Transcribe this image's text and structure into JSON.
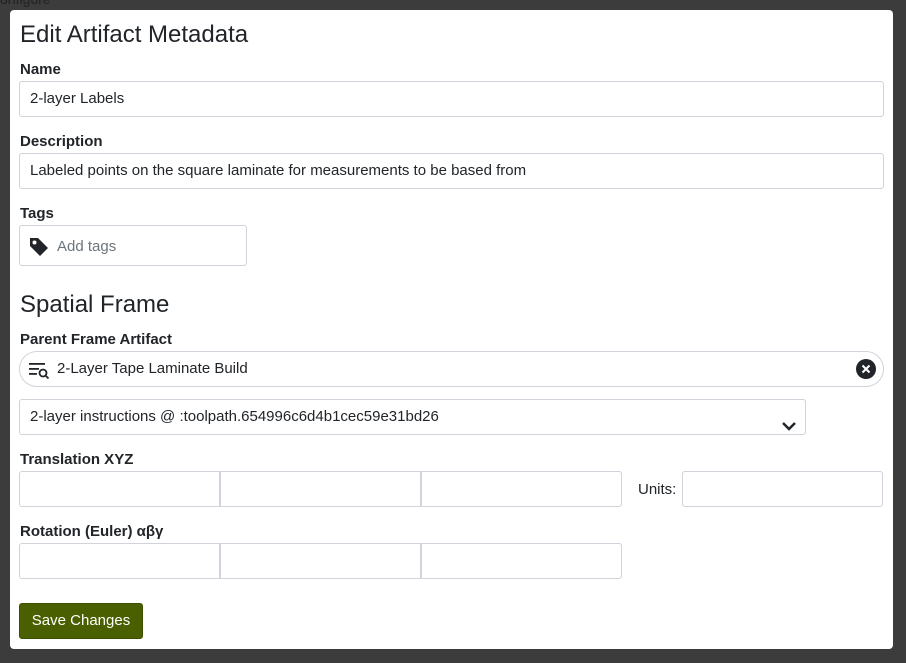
{
  "background": {
    "partial_text": "onfigure"
  },
  "modal": {
    "title": "Edit Artifact Metadata",
    "name": {
      "label": "Name",
      "value": "2-layer Labels"
    },
    "description": {
      "label": "Description",
      "value": "Labeled points on the square laminate for measurements to be based from"
    },
    "tags": {
      "label": "Tags",
      "placeholder": "Add tags",
      "icon": "tag-icon"
    },
    "spatial_frame": {
      "title": "Spatial Frame",
      "parent_label": "Parent Frame Artifact",
      "parent_value": "2-Layer Tape Laminate Build",
      "toolpath_select": "2-layer instructions @ :toolpath.654996c6d4b1cec59e31bd26",
      "translation_label": "Translation XYZ",
      "units_label": "Units:",
      "rotation_label": "Rotation (Euler) αβγ"
    },
    "save_label": "Save Changes"
  },
  "colors": {
    "save_button": "#4a5f00",
    "border": "#ced4da",
    "overlay": "#3c3c3c"
  }
}
